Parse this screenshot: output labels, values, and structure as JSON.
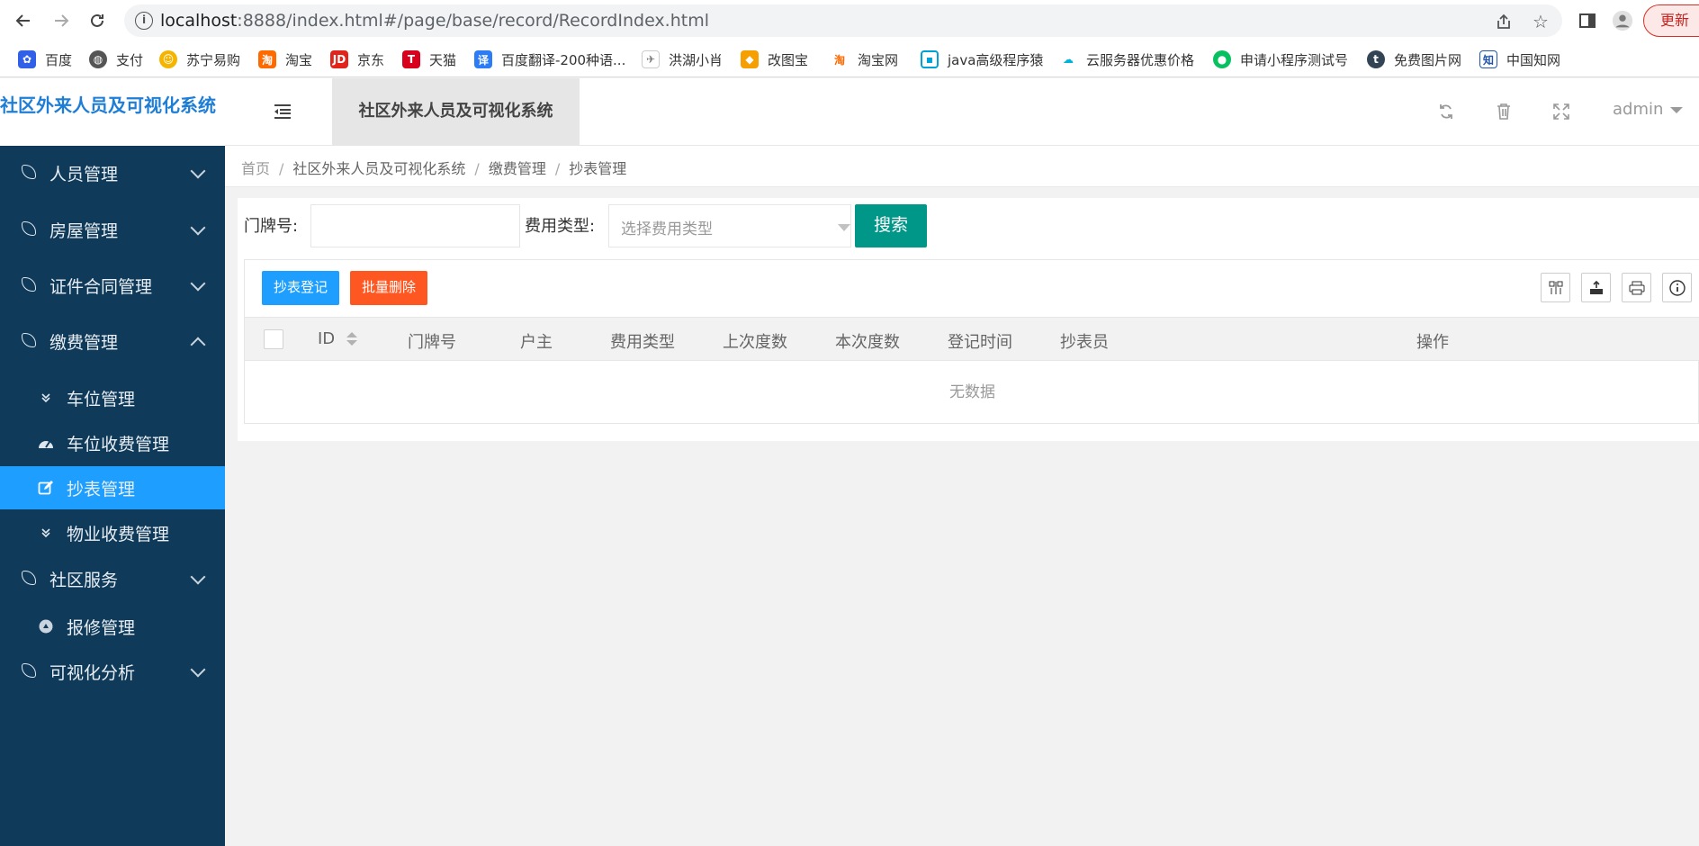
{
  "browser": {
    "url_host": "localhost",
    "url_rest": ":8888/index.html#/page/base/record/RecordIndex.html",
    "update_label": "更新"
  },
  "bookmarks": [
    {
      "label": "百度",
      "color": "#3060e8"
    },
    {
      "label": "支付",
      "color": "#555555"
    },
    {
      "label": "苏宁易购",
      "color": "#f5b400"
    },
    {
      "label": "淘宝",
      "color": "#ff6a00"
    },
    {
      "label": "京东",
      "color": "#e1251b"
    },
    {
      "label": "天猫",
      "color": "#d8001c"
    },
    {
      "label": "百度翻译-200种语...",
      "color": "#2b7cf6"
    },
    {
      "label": "洪湖小肖",
      "color": "#777777"
    },
    {
      "label": "改图宝",
      "color": "#f5a000"
    },
    {
      "label": "淘宝网",
      "color": "#ff6a00"
    },
    {
      "label": "java高级程序猿",
      "color": "#00a1d6"
    },
    {
      "label": "云服务器优惠价格",
      "color": "#00b4d8"
    },
    {
      "label": "申请小程序测试号",
      "color": "#07c160"
    },
    {
      "label": "免费图片网",
      "color": "#334455"
    },
    {
      "label": "中国知网",
      "color": "#2255aa"
    }
  ],
  "header": {
    "logo": "社区外来人员及可视化系统",
    "tab": "社区外来人员及可视化系统",
    "user": "admin"
  },
  "sidebar": {
    "items": [
      {
        "label": "人员管理"
      },
      {
        "label": "房屋管理"
      },
      {
        "label": "证件合同管理"
      },
      {
        "label": "缴费管理"
      },
      {
        "label": "社区服务"
      },
      {
        "label": "可视化分析"
      }
    ],
    "sub": [
      {
        "label": "车位管理"
      },
      {
        "label": "车位收费管理"
      },
      {
        "label": "抄表管理"
      },
      {
        "label": "物业收费管理"
      },
      {
        "label": "报修管理"
      }
    ]
  },
  "breadcrumb": [
    "首页",
    "社区外来人员及可视化系统",
    "缴费管理",
    "抄表管理"
  ],
  "search": {
    "door_label": "门牌号:",
    "type_label": "费用类型:",
    "type_placeholder": "选择费用类型",
    "button": "搜索"
  },
  "toolbar": {
    "add": "抄表登记",
    "batch_delete": "批量删除"
  },
  "table": {
    "columns": [
      "ID",
      "门牌号",
      "户主",
      "费用类型",
      "上次度数",
      "本次度数",
      "登记时间",
      "抄表员",
      "操作"
    ],
    "empty": "无数据"
  }
}
